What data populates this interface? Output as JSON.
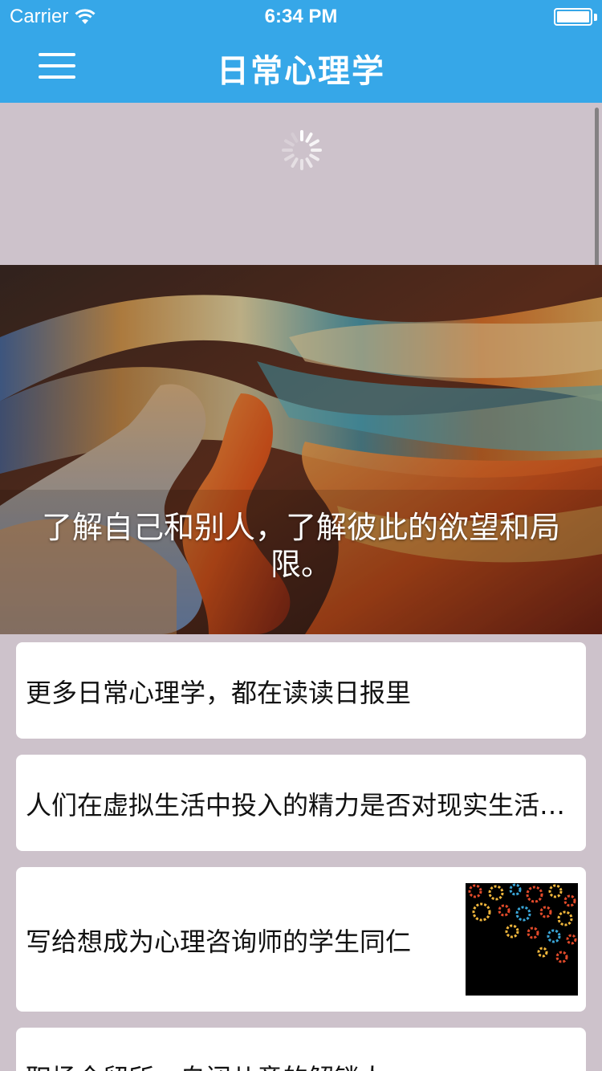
{
  "status_bar": {
    "carrier": "Carrier",
    "time": "6:34 PM",
    "icons": [
      "wifi-icon",
      "battery-icon"
    ]
  },
  "nav": {
    "title": "日常心理学",
    "menu_icon": "hamburger-menu-icon",
    "background": "#36a7e8"
  },
  "hero": {
    "caption": "了解自己和别人，了解彼此的欲望和局限。",
    "image": "colorful-faces-painting"
  },
  "articles": [
    {
      "title": "更多日常心理学，都在读读日报里",
      "has_thumbnail": false
    },
    {
      "title": "人们在虚拟生活中投入的精力是否对现实生活造成影响",
      "has_thumbnail": false
    },
    {
      "title": "写给想成为心理咨询师的学生同仁",
      "has_thumbnail": true,
      "thumbnail": "colorful-gears-image"
    },
    {
      "title": "职场全留所，自闭儿童的解锁人",
      "has_thumbnail": false
    }
  ],
  "colors": {
    "page_background": "#cdc2cb",
    "card_background": "#ffffff",
    "text": "#111111"
  }
}
